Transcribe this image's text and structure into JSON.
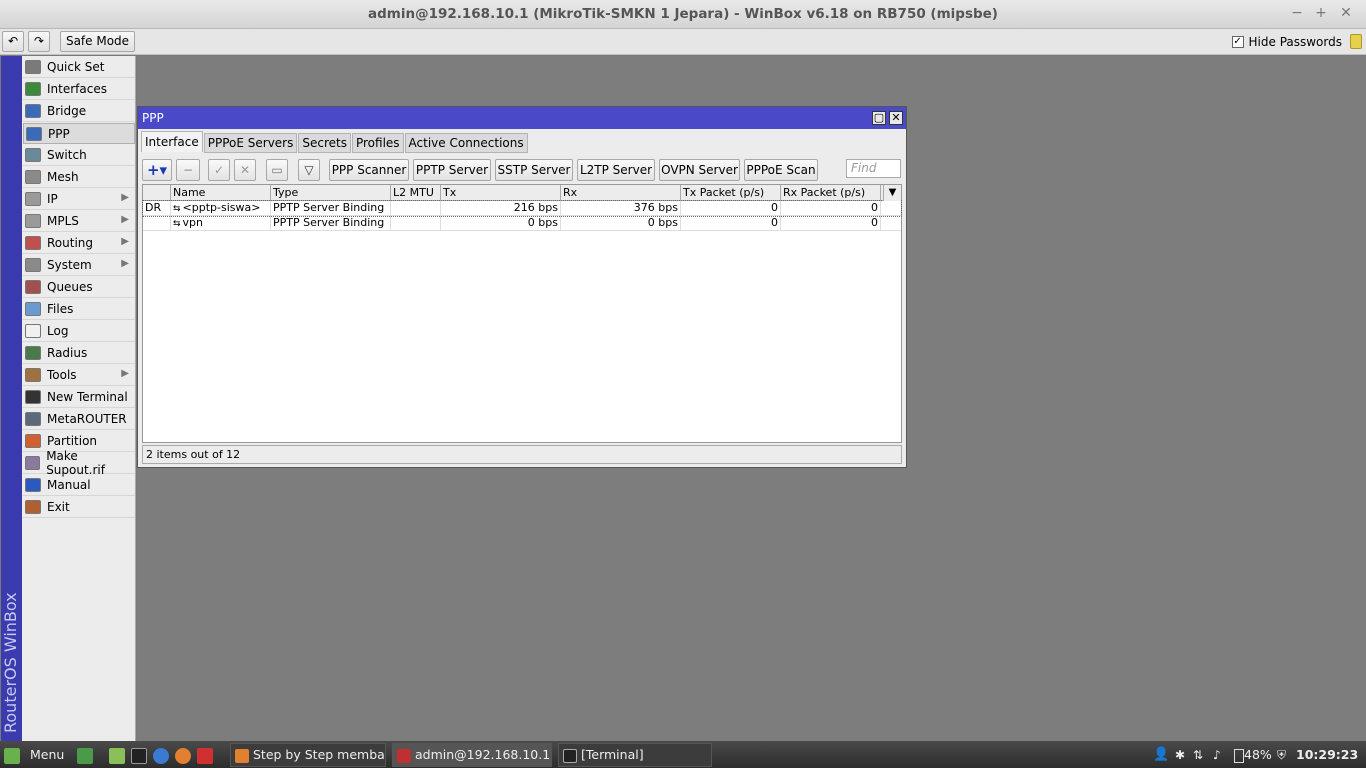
{
  "window": {
    "title": "admin@192.168.10.1 (MikroTik-SMKN 1 Jepara) - WinBox v6.18 on RB750 (mipsbe)"
  },
  "toolbar": {
    "undo": "↶",
    "redo": "↷",
    "safe_mode": "Safe Mode",
    "hide_passwords": "Hide Passwords",
    "hide_passwords_checked": true
  },
  "brand": "RouterOS WinBox",
  "sidebar": {
    "items": [
      {
        "label": "Quick Set",
        "icon": "quick-set-icon",
        "color": "#7a7a7a"
      },
      {
        "label": "Interfaces",
        "icon": "interfaces-icon",
        "color": "#3a8a3a"
      },
      {
        "label": "Bridge",
        "icon": "bridge-icon",
        "color": "#3a6ab8"
      },
      {
        "label": "PPP",
        "icon": "ppp-icon",
        "color": "#3a6ab8"
      },
      {
        "label": "Switch",
        "icon": "switch-icon",
        "color": "#6a8a9a"
      },
      {
        "label": "Mesh",
        "icon": "mesh-icon",
        "color": "#8a8a8a"
      },
      {
        "label": "IP",
        "icon": "ip-icon",
        "color": "#9a9a9a",
        "submenu": true
      },
      {
        "label": "MPLS",
        "icon": "mpls-icon",
        "color": "#9a9a9a",
        "submenu": true
      },
      {
        "label": "Routing",
        "icon": "routing-icon",
        "color": "#c05050",
        "submenu": true
      },
      {
        "label": "System",
        "icon": "system-icon",
        "color": "#8a8a8a",
        "submenu": true
      },
      {
        "label": "Queues",
        "icon": "queues-icon",
        "color": "#a05050"
      },
      {
        "label": "Files",
        "icon": "files-icon",
        "color": "#6a9ad0"
      },
      {
        "label": "Log",
        "icon": "log-icon",
        "color": "#f0f0f0"
      },
      {
        "label": "Radius",
        "icon": "radius-icon",
        "color": "#4a7a4a"
      },
      {
        "label": "Tools",
        "icon": "tools-icon",
        "color": "#a07040",
        "submenu": true
      },
      {
        "label": "New Terminal",
        "icon": "terminal-icon",
        "color": "#333333"
      },
      {
        "label": "MetaROUTER",
        "icon": "metarouter-icon",
        "color": "#5a6a7a"
      },
      {
        "label": "Partition",
        "icon": "partition-icon",
        "color": "#d06030"
      },
      {
        "label": "Make Supout.rif",
        "icon": "supout-icon",
        "color": "#8a7aa0"
      },
      {
        "label": "Manual",
        "icon": "manual-icon",
        "color": "#2a5ac0"
      },
      {
        "label": "Exit",
        "icon": "exit-icon",
        "color": "#b06030"
      }
    ]
  },
  "ppp": {
    "title": "PPP",
    "tabs": [
      "Interface",
      "PPPoE Servers",
      "Secrets",
      "Profiles",
      "Active Connections"
    ],
    "buttons": [
      "PPP Scanner",
      "PPTP Server",
      "SSTP Server",
      "L2TP Server",
      "OVPN Server",
      "PPPoE Scan"
    ],
    "find_placeholder": "Find",
    "columns": [
      "",
      "Name",
      "Type",
      "L2 MTU",
      "Tx",
      "Rx",
      "Tx Packet (p/s)",
      "Rx Packet (p/s)"
    ],
    "rows": [
      {
        "flags": "DR",
        "name": "<pptp-siswa>",
        "type": "PPTP Server Binding",
        "l2mtu": "",
        "tx": "216 bps",
        "rx": "376 bps",
        "txp": "0",
        "rxp": "0"
      },
      {
        "flags": "",
        "name": "vpn",
        "type": "PPTP Server Binding",
        "l2mtu": "",
        "tx": "0 bps",
        "rx": "0 bps",
        "txp": "0",
        "rxp": "0"
      }
    ],
    "status": "2 items out of 12"
  },
  "taskbar": {
    "menu": "Menu",
    "windows": [
      "Step by Step memba...",
      "admin@192.168.10.1...",
      "[Terminal]"
    ],
    "battery": "48%",
    "clock": "10:29:23"
  }
}
